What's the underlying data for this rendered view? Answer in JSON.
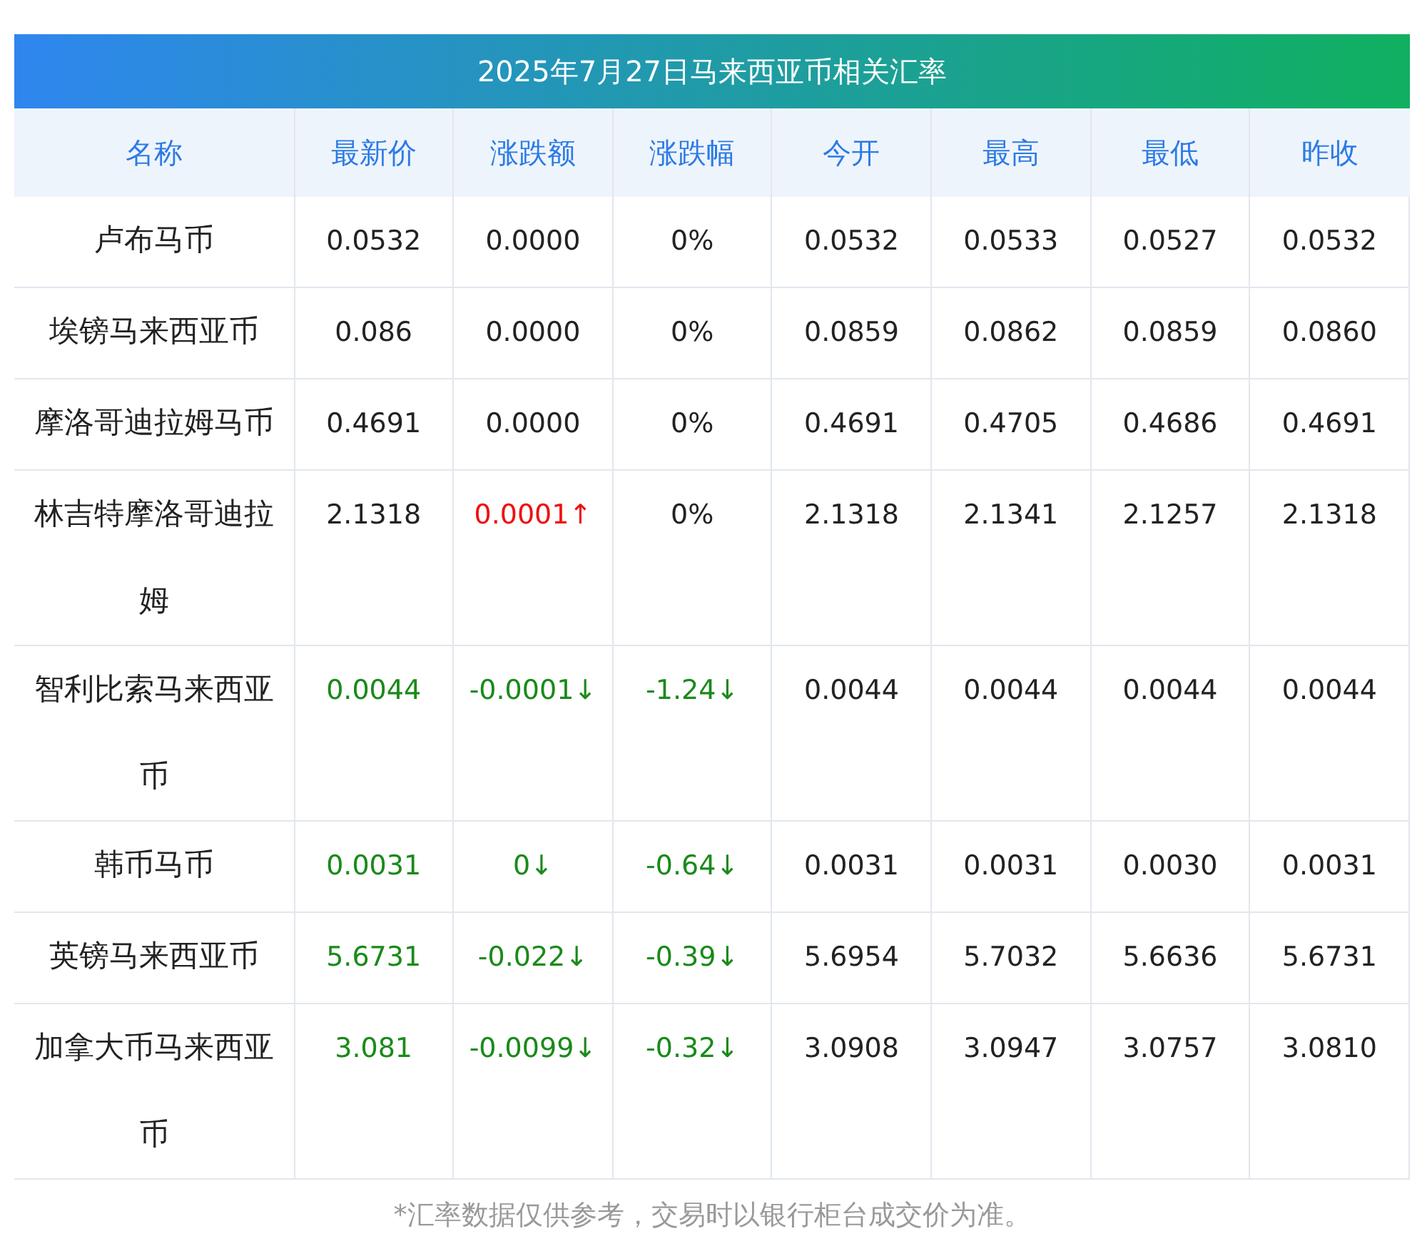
{
  "title": "2025年7月27日马来西亚币相关汇率",
  "columns": [
    "名称",
    "最新价",
    "涨跌额",
    "涨跌幅",
    "今开",
    "最高",
    "最低",
    "昨收"
  ],
  "rows": [
    {
      "name": "卢布马币",
      "latest": {
        "text": "0.0532",
        "color": "#222222"
      },
      "change": {
        "text": "0.0000",
        "color": "#222222"
      },
      "percent": {
        "text": "0%",
        "color": "#222222"
      },
      "open": "0.0532",
      "high": "0.0533",
      "low": "0.0527",
      "prev": "0.0532"
    },
    {
      "name": "埃镑马来西亚币",
      "latest": {
        "text": "0.086",
        "color": "#222222"
      },
      "change": {
        "text": "0.0000",
        "color": "#222222"
      },
      "percent": {
        "text": "0%",
        "color": "#222222"
      },
      "open": "0.0859",
      "high": "0.0862",
      "low": "0.0859",
      "prev": "0.0860"
    },
    {
      "name": "摩洛哥迪拉姆马币",
      "latest": {
        "text": "0.4691",
        "color": "#222222"
      },
      "change": {
        "text": "0.0000",
        "color": "#222222"
      },
      "percent": {
        "text": "0%",
        "color": "#222222"
      },
      "open": "0.4691",
      "high": "0.4705",
      "low": "0.4686",
      "prev": "0.4691"
    },
    {
      "name": "林吉特摩洛哥迪拉姆",
      "latest": {
        "text": "2.1318",
        "color": "#222222"
      },
      "change": {
        "text": "0.0001↑",
        "color": "#ee1111"
      },
      "percent": {
        "text": "0%",
        "color": "#222222"
      },
      "open": "2.1318",
      "high": "2.1341",
      "low": "2.1257",
      "prev": "2.1318"
    },
    {
      "name": "智利比索马来西亚币",
      "latest": {
        "text": "0.0044",
        "color": "#1a8a1a"
      },
      "change": {
        "text": "-0.0001↓",
        "color": "#1a8a1a"
      },
      "percent": {
        "text": "-1.24↓",
        "color": "#1a8a1a"
      },
      "open": "0.0044",
      "high": "0.0044",
      "low": "0.0044",
      "prev": "0.0044"
    },
    {
      "name": "韩币马币",
      "latest": {
        "text": "0.0031",
        "color": "#1a8a1a"
      },
      "change": {
        "text": "0↓",
        "color": "#1a8a1a"
      },
      "percent": {
        "text": "-0.64↓",
        "color": "#1a8a1a"
      },
      "open": "0.0031",
      "high": "0.0031",
      "low": "0.0030",
      "prev": "0.0031"
    },
    {
      "name": "英镑马来西亚币",
      "latest": {
        "text": "5.6731",
        "color": "#1a8a1a"
      },
      "change": {
        "text": "-0.022↓",
        "color": "#1a8a1a"
      },
      "percent": {
        "text": "-0.39↓",
        "color": "#1a8a1a"
      },
      "open": "5.6954",
      "high": "5.7032",
      "low": "5.6636",
      "prev": "5.6731"
    },
    {
      "name": "加拿大币马来西亚币",
      "latest": {
        "text": "3.081",
        "color": "#1a8a1a"
      },
      "change": {
        "text": "-0.0099↓",
        "color": "#1a8a1a"
      },
      "percent": {
        "text": "-0.32↓",
        "color": "#1a8a1a"
      },
      "open": "3.0908",
      "high": "3.0947",
      "low": "3.0757",
      "prev": "3.0810"
    }
  ],
  "note": "*汇率数据仅供参考，交易时以银行柜台成交价为准。"
}
